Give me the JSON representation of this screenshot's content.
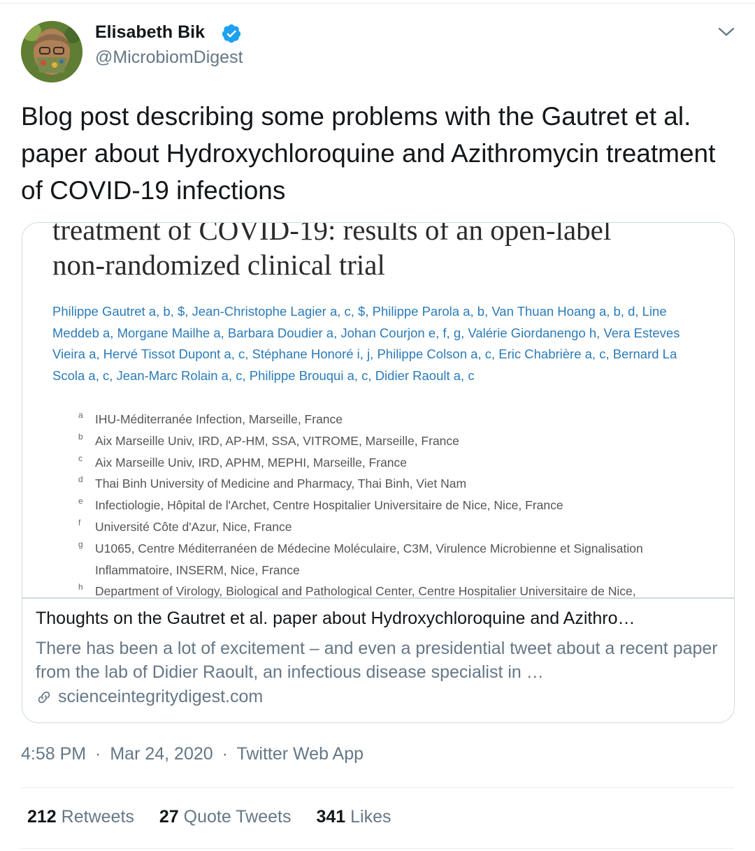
{
  "author": {
    "display_name": "Elisabeth Bik",
    "handle": "@MicrobiomDigest",
    "verified": true
  },
  "tweet": {
    "text": "Blog post describing some problems with the Gautret et al. paper about Hydroxychloroquine and Azithromycin treatment of COVID-19 infections"
  },
  "card": {
    "image": {
      "title_cut": "treatment of COVID-19: results of an open-label",
      "title": "non-randomized clinical trial",
      "authors": "Philippe Gautret a, b, $, Jean-Christophe Lagier a, c, $, Philippe Parola a, b, Van Thuan Hoang a, b, d, Line Meddeb a, Morgane Mailhe a, Barbara Doudier a, Johan Courjon e, f, g, Valérie Giordanengo h, Vera Esteves Vieira a, Hervé Tissot Dupont a, c, Stéphane Honoré i, j, Philippe Colson a, c, Eric Chabrière a, c, Bernard La Scola a, c, Jean-Marc Rolain a, c, Philippe Brouqui a, c, Didier Raoult a, c",
      "affiliations": [
        {
          "letter": "a",
          "text": "IHU-Méditerranée Infection, Marseille, France"
        },
        {
          "letter": "b",
          "text": "Aix Marseille Univ, IRD, AP-HM, SSA, VITROME, Marseille, France"
        },
        {
          "letter": "c",
          "text": "Aix Marseille Univ, IRD, APHM, MEPHI, Marseille, France"
        },
        {
          "letter": "d",
          "text": "Thai Binh University of Medicine and Pharmacy, Thai Binh, Viet Nam"
        },
        {
          "letter": "e",
          "text": "Infectiologie, Hôpital de l'Archet, Centre Hospitalier Universitaire de Nice, Nice, France"
        },
        {
          "letter": "f",
          "text": "Université Côte d'Azur, Nice, France"
        },
        {
          "letter": "g",
          "text": "U1065, Centre Méditerranéen de Médecine Moléculaire, C3M, Virulence Microbienne et Signalisation"
        },
        {
          "letter": "",
          "text": "Inflammatoire, INSERM, Nice, France"
        },
        {
          "letter": "h",
          "text": "Department of Virology, Biological and Pathological Center, Centre Hospitalier Universitaire de Nice,"
        }
      ]
    },
    "title": "Thoughts on the Gautret et al. paper about Hydroxychloroquine and Azithro…",
    "description": "There has been a lot of excitement – and even a presidential tweet about a recent paper from the lab of Didier Raoult, an infectious disease specialist in …",
    "domain": "scienceintegritydigest.com"
  },
  "meta": {
    "time": "4:58 PM",
    "date": "Mar 24, 2020",
    "source": "Twitter Web App",
    "separator": "·"
  },
  "stats": {
    "retweets_count": "212",
    "retweets_label": "Retweets",
    "quotes_count": "27",
    "quotes_label": "Quote Tweets",
    "likes_count": "341",
    "likes_label": "Likes"
  },
  "colors": {
    "text_primary": "#14171a",
    "text_secondary": "#657786",
    "verified_blue": "#1da1f2",
    "border": "#cfd9de",
    "author_link_blue": "#2b7bb9"
  }
}
